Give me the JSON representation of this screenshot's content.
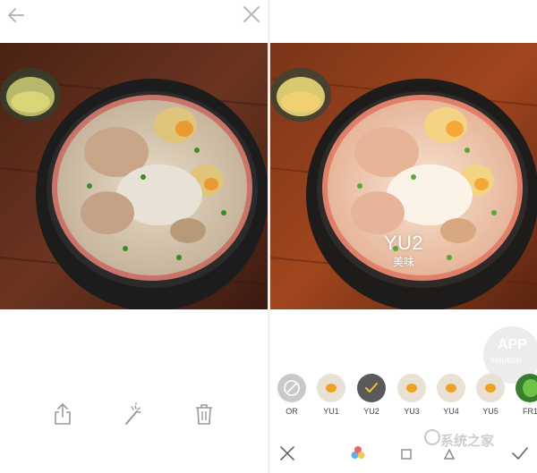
{
  "header": {
    "back_icon": "back-arrow-icon",
    "close_icon": "close-icon"
  },
  "preview": {
    "filter_name": "YU2",
    "filter_subtitle": "美味"
  },
  "tools": [
    {
      "icon": "share-icon"
    },
    {
      "icon": "magic-wand-icon"
    },
    {
      "icon": "trash-icon"
    }
  ],
  "watermark": {
    "line1": "APP",
    "line2": "solution",
    "site": "系统之家"
  },
  "filters": [
    {
      "label": "OR",
      "style": "none"
    },
    {
      "label": "YU1",
      "style": "food"
    },
    {
      "label": "YU2",
      "style": "selected"
    },
    {
      "label": "YU3",
      "style": "food"
    },
    {
      "label": "YU4",
      "style": "food"
    },
    {
      "label": "YU5",
      "style": "food"
    },
    {
      "label": "FR1",
      "style": "green"
    }
  ],
  "bottom_bar": {
    "cancel_icon": "cancel-x-icon",
    "palette_icon": "color-palette-icon",
    "confirm_icon": "checkmark-icon"
  },
  "colors": {
    "selected_filter": "#5a5a5a",
    "table_wood": "#5a2a16",
    "bowl_rim": "#1a1a1a",
    "broth": "#e6d6c0"
  }
}
